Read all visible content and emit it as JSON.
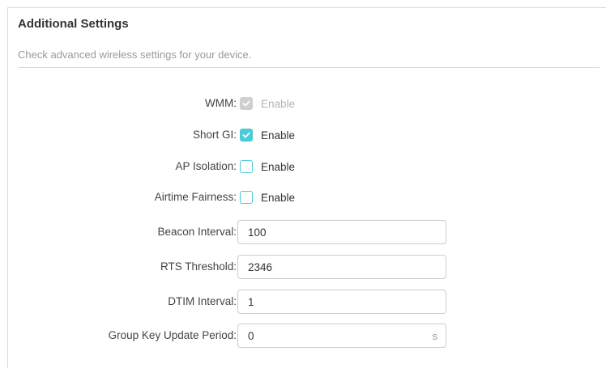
{
  "section": {
    "title": "Additional Settings",
    "description": "Check advanced wireless settings for your device."
  },
  "wmm": {
    "label": "WMM:",
    "checkbox_label": "Enable",
    "checked": true,
    "disabled": true
  },
  "short_gi": {
    "label": "Short GI:",
    "checkbox_label": "Enable",
    "checked": true,
    "disabled": false
  },
  "ap_isolation": {
    "label": "AP Isolation:",
    "checkbox_label": "Enable",
    "checked": false,
    "disabled": false
  },
  "airtime_fairness": {
    "label": "Airtime Fairness:",
    "checkbox_label": "Enable",
    "checked": false,
    "disabled": false
  },
  "beacon_interval": {
    "label": "Beacon Interval:",
    "value": "100"
  },
  "rts_threshold": {
    "label": "RTS Threshold:",
    "value": "2346"
  },
  "dtim_interval": {
    "label": "DTIM Interval:",
    "value": "1"
  },
  "group_key_update_period": {
    "label": "Group Key Update Period:",
    "value": "0",
    "unit": "s"
  },
  "colors": {
    "accent": "#4acbd6",
    "disabled": "#cfcfcf",
    "border": "#cccccc",
    "muted_text": "#9a9a9a"
  }
}
